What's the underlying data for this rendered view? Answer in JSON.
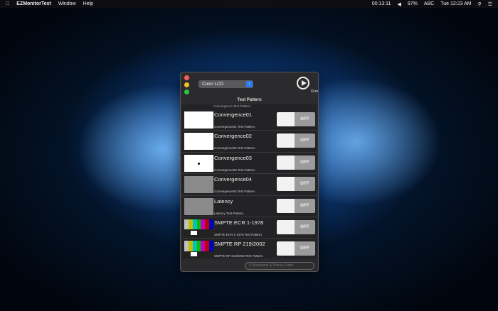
{
  "menubar": {
    "app": "EZMonitorTest",
    "items": [
      "Window",
      "Help"
    ],
    "timer": "00:13:11",
    "battery": "97%",
    "input": "ABC",
    "clock": "Tue 12:23 AM"
  },
  "window": {
    "display_select": "Color LCD",
    "run_label": "Run",
    "header": "Test Pattern",
    "partial_row": "Convergence Test Pattern.",
    "rows": [
      {
        "title": "Convergence01",
        "desc": "Convergence01 Test Pattern.",
        "toggle": "OFF",
        "thumb": "grid"
      },
      {
        "title": "Convergence02",
        "desc": "Convergence02 Test Pattern.",
        "toggle": "OFF",
        "thumb": "white"
      },
      {
        "title": "Convergence03",
        "desc": "Convergence03 Test Pattern.",
        "toggle": "OFF",
        "thumb": "dot"
      },
      {
        "title": "Convergence04",
        "desc": "Convergence04 Test Pattern.",
        "toggle": "OFF",
        "thumb": "gray"
      },
      {
        "title": "Latency",
        "desc": "Latency Test Pattern.",
        "toggle": "OFF",
        "thumb": "latency"
      },
      {
        "title": "SMPTE ECR 1-1978",
        "desc": "SMPTE ECR 1-1978 Test Pattern.",
        "toggle": "OFF",
        "thumb": "bars"
      },
      {
        "title": "SMPTE RP 219/2002",
        "desc": "SMPTE RP 219/2002 Test Pattern.",
        "toggle": "OFF",
        "thumb": "bars"
      }
    ],
    "search_placeholder": "Keyword & Press Enter"
  },
  "colors": {
    "close": "#fc5f57",
    "minimize": "#fdbc2e",
    "zoom": "#28c840",
    "select_arrow": "#2f7bf5"
  }
}
